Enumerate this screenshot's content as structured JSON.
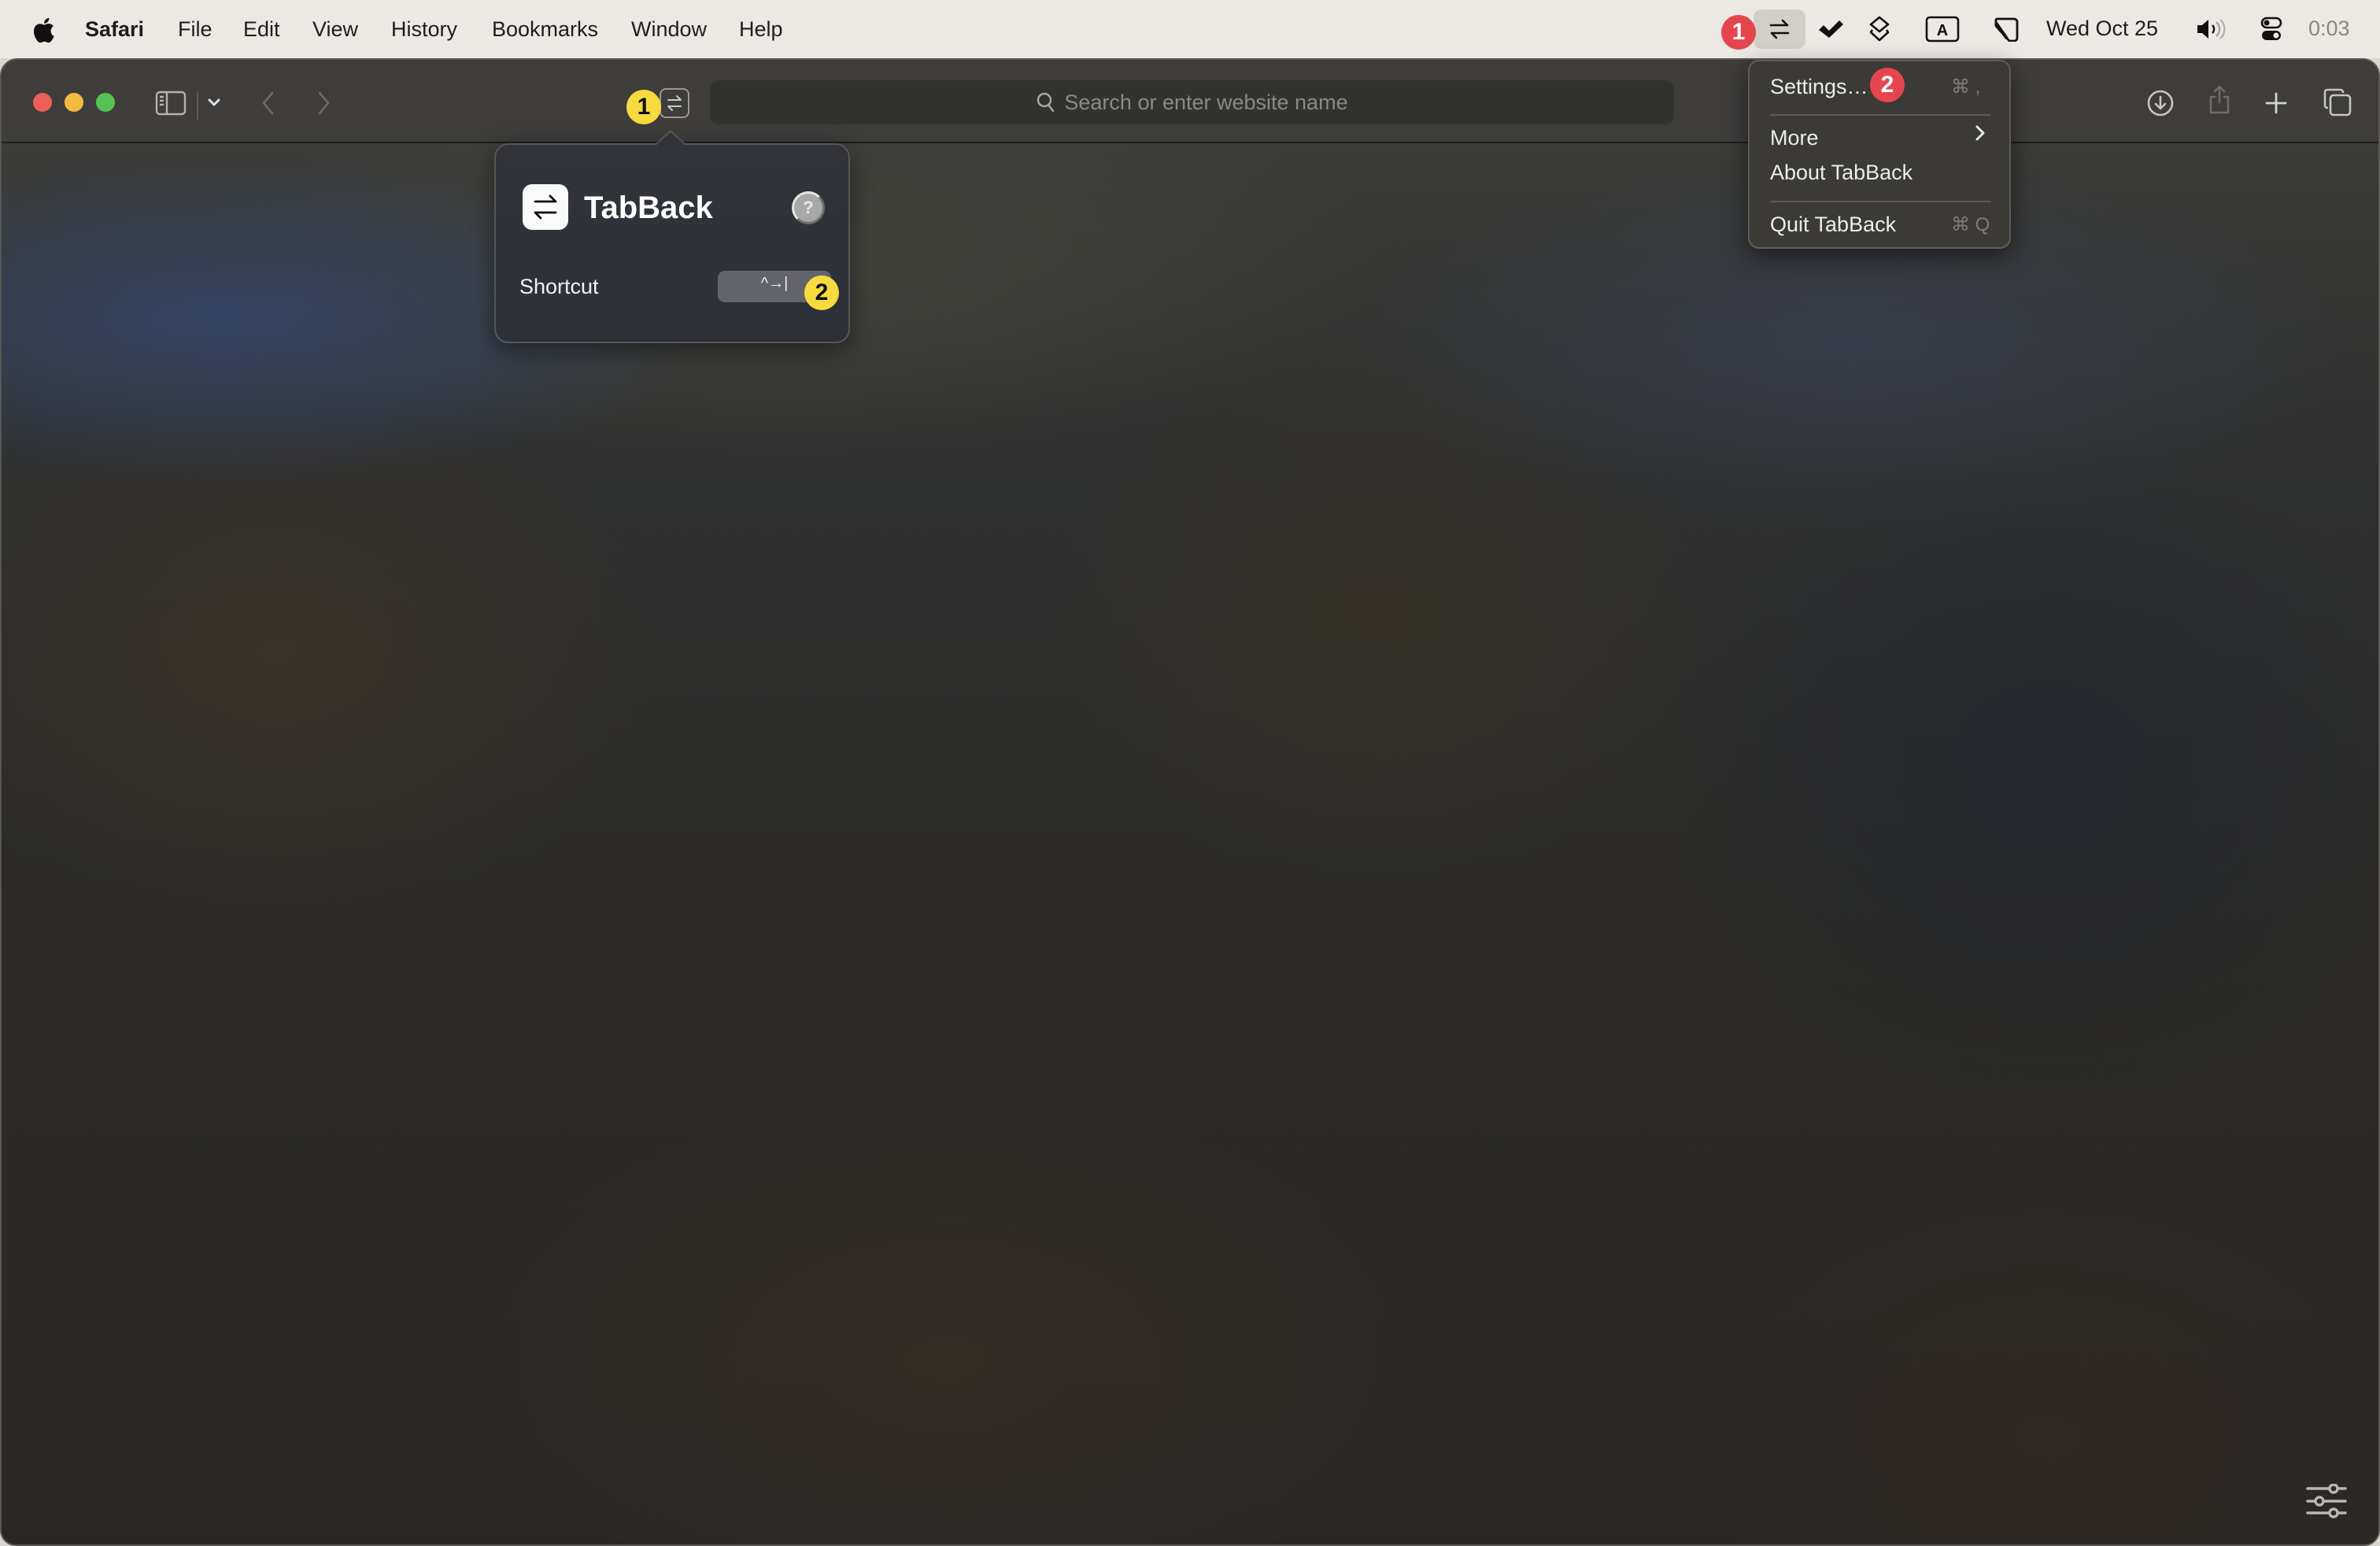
{
  "menubar": {
    "apple_icon": "apple-logo-icon",
    "app_name": "Safari",
    "items": [
      "File",
      "Edit",
      "View",
      "History",
      "Bookmarks",
      "Window",
      "Help"
    ],
    "status_icons": [
      "tabback-swap-icon",
      "checkmark-icon",
      "layers-icon",
      "input-source-A-icon",
      "stage-manager-icon",
      "volume-icon",
      "control-center-icon"
    ],
    "date": "Wed Oct 25",
    "time": "0:03",
    "input_source_letter": "A"
  },
  "annotations": {
    "menubar_badge": "1",
    "settings_badge": "2",
    "toolbar_badge": "1",
    "shortcut_badge": "2",
    "colors": {
      "red": "#e5464e",
      "yellow": "#f7da3e"
    }
  },
  "toolbar": {
    "icons": [
      "close",
      "minimize",
      "zoom",
      "sidebar-icon",
      "chevron-down-icon",
      "back-icon",
      "forward-icon",
      "tabback-extension-icon",
      "download-icon",
      "share-icon",
      "new-tab-icon",
      "tab-overview-icon"
    ],
    "search_placeholder": "Search or enter website name"
  },
  "popover": {
    "app_name": "TabBack",
    "help_label": "?",
    "shortcut_label": "Shortcut",
    "shortcut_value": "^→|"
  },
  "dropdown": {
    "items": [
      {
        "label": "Settings…",
        "shortcut": "⌘ ,"
      },
      {
        "label": "More",
        "submenu": true
      },
      {
        "label": "About TabBack"
      },
      {
        "label": "Quit TabBack",
        "shortcut": "⌘ Q"
      }
    ]
  },
  "page": {
    "customize_icon": "sliders-icon"
  }
}
